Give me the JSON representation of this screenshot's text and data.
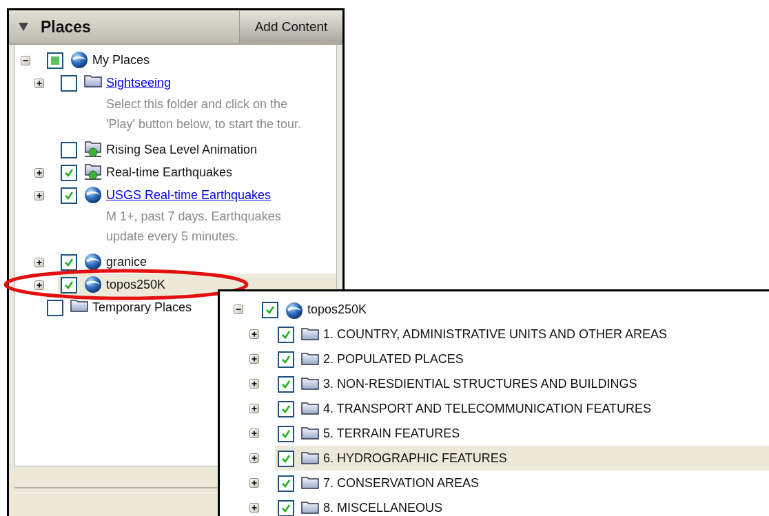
{
  "places": {
    "title": "Places",
    "add_button": "Add Content",
    "tree": [
      {
        "label": "My Places",
        "kind": "globe",
        "link": false,
        "has_children": true,
        "expanded": true,
        "checked": false,
        "partial": true,
        "selected": false,
        "children": [
          {
            "label": "Sightseeing",
            "kind": "folder",
            "link": true,
            "has_children": true,
            "expanded": false,
            "checked": false,
            "partial": false,
            "selected": false,
            "description": "Select this folder and click on the\n'Play' button below, to start the tour."
          },
          {
            "label": "Rising Sea Level Animation",
            "kind": "network",
            "link": false,
            "has_children": false,
            "checked": false,
            "partial": false,
            "selected": false
          },
          {
            "label": "Real-time Earthquakes",
            "kind": "network",
            "link": false,
            "has_children": true,
            "expanded": false,
            "checked": true,
            "partial": false,
            "selected": false
          },
          {
            "label": "USGS Real-time Earthquakes",
            "kind": "globe",
            "link": true,
            "has_children": true,
            "expanded": false,
            "checked": true,
            "partial": false,
            "selected": false,
            "description": "M 1+, past 7 days. Earthquakes\nupdate every 5 minutes."
          },
          {
            "label": "granice",
            "kind": "globe",
            "link": false,
            "has_children": true,
            "expanded": false,
            "checked": true,
            "partial": false,
            "selected": false
          },
          {
            "label": "topos250K",
            "kind": "globe",
            "link": false,
            "has_children": true,
            "expanded": false,
            "checked": true,
            "partial": false,
            "selected": true
          }
        ]
      },
      {
        "label": "Temporary Places",
        "kind": "folder",
        "link": false,
        "has_children": false,
        "checked": false,
        "partial": false,
        "selected": false
      }
    ]
  },
  "inset_tree": [
    {
      "label": "topos250K",
      "kind": "globe",
      "link": false,
      "has_children": true,
      "expanded": true,
      "checked": true,
      "partial": false,
      "selected": false,
      "children": [
        {
          "label": "1. COUNTRY, ADMINISTRATIVE UNITS AND OTHER AREAS",
          "kind": "folder",
          "link": false,
          "has_children": true,
          "expanded": false,
          "checked": true,
          "partial": false,
          "selected": false
        },
        {
          "label": "2. POPULATED PLACES",
          "kind": "folder",
          "link": false,
          "has_children": true,
          "expanded": false,
          "checked": true,
          "partial": false,
          "selected": false
        },
        {
          "label": "3. NON-RESDIENTIAL STRUCTURES AND BUILDINGS",
          "kind": "folder",
          "link": false,
          "has_children": true,
          "expanded": false,
          "checked": true,
          "partial": false,
          "selected": false
        },
        {
          "label": "4. TRANSPORT AND TELECOMMUNICATION FEATURES",
          "kind": "folder",
          "link": false,
          "has_children": true,
          "expanded": false,
          "checked": true,
          "partial": false,
          "selected": false
        },
        {
          "label": "5. TERRAIN FEATURES",
          "kind": "folder",
          "link": false,
          "has_children": true,
          "expanded": false,
          "checked": true,
          "partial": false,
          "selected": false
        },
        {
          "label": "6. HYDROGRAPHIC FEATURES",
          "kind": "folder",
          "link": false,
          "has_children": true,
          "expanded": false,
          "checked": true,
          "partial": false,
          "selected": true
        },
        {
          "label": "7. CONSERVATION AREAS",
          "kind": "folder",
          "link": false,
          "has_children": true,
          "expanded": false,
          "checked": true,
          "partial": false,
          "selected": false
        },
        {
          "label": "8. MISCELLANEOUS",
          "kind": "folder",
          "link": false,
          "has_children": true,
          "expanded": false,
          "checked": true,
          "partial": false,
          "selected": false
        }
      ]
    }
  ]
}
